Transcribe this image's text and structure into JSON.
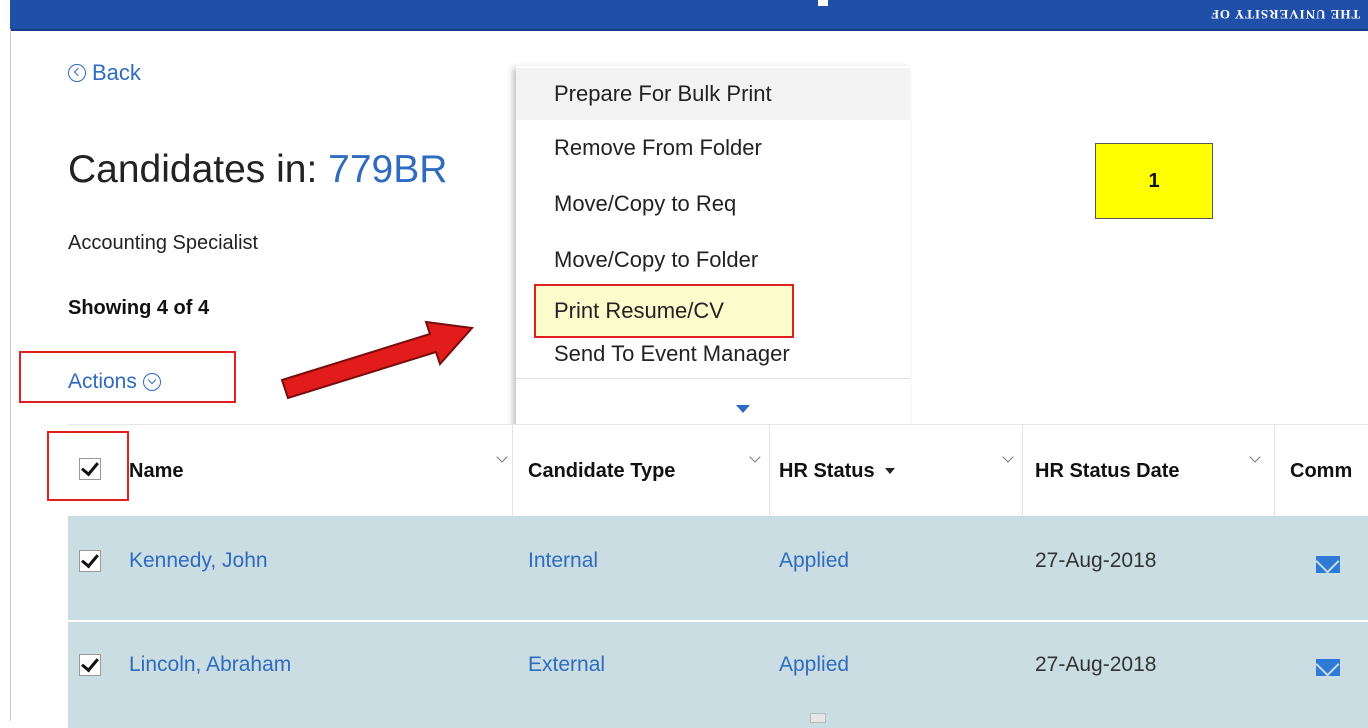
{
  "topbar": {
    "text": "THE UNIVERSITY OF"
  },
  "back": {
    "label": "Back"
  },
  "title": {
    "prefix": "Candidates in: ",
    "req_id": "779BR"
  },
  "subtitle": "Accounting Specialist",
  "showing": "Showing 4 of 4",
  "actions": {
    "label": "Actions"
  },
  "actions_menu": {
    "items": [
      "Prepare For Bulk Print",
      "Remove From Folder",
      "Move/Copy to Req",
      "Move/Copy to Folder",
      "Print Resume/CV",
      "Send To Event Manager"
    ],
    "highlighted": "Print Resume/CV"
  },
  "callout": {
    "label": "1"
  },
  "table": {
    "columns": [
      "Name",
      "Candidate Type",
      "HR Status",
      "HR Status Date",
      "Comm"
    ],
    "sorted_column": "HR Status",
    "rows": [
      {
        "name": "Kennedy, John",
        "type": "Internal",
        "status": "Applied",
        "date": "27-Aug-2018"
      },
      {
        "name": "Lincoln, Abraham",
        "type": "External",
        "status": "Applied",
        "date": "27-Aug-2018"
      }
    ]
  },
  "colors": {
    "link": "#2f6bbf",
    "annotation_red": "#e02020",
    "callout_yellow": "#ffff00",
    "row_bg": "#c9dde2",
    "topbar": "#1f4fa8"
  },
  "icons": [
    "back-circle-icon",
    "chevron-down-circle-icon",
    "checkbox-checked-icon",
    "mail-icon",
    "sort-caret-icon",
    "scroll-down-icon"
  ]
}
